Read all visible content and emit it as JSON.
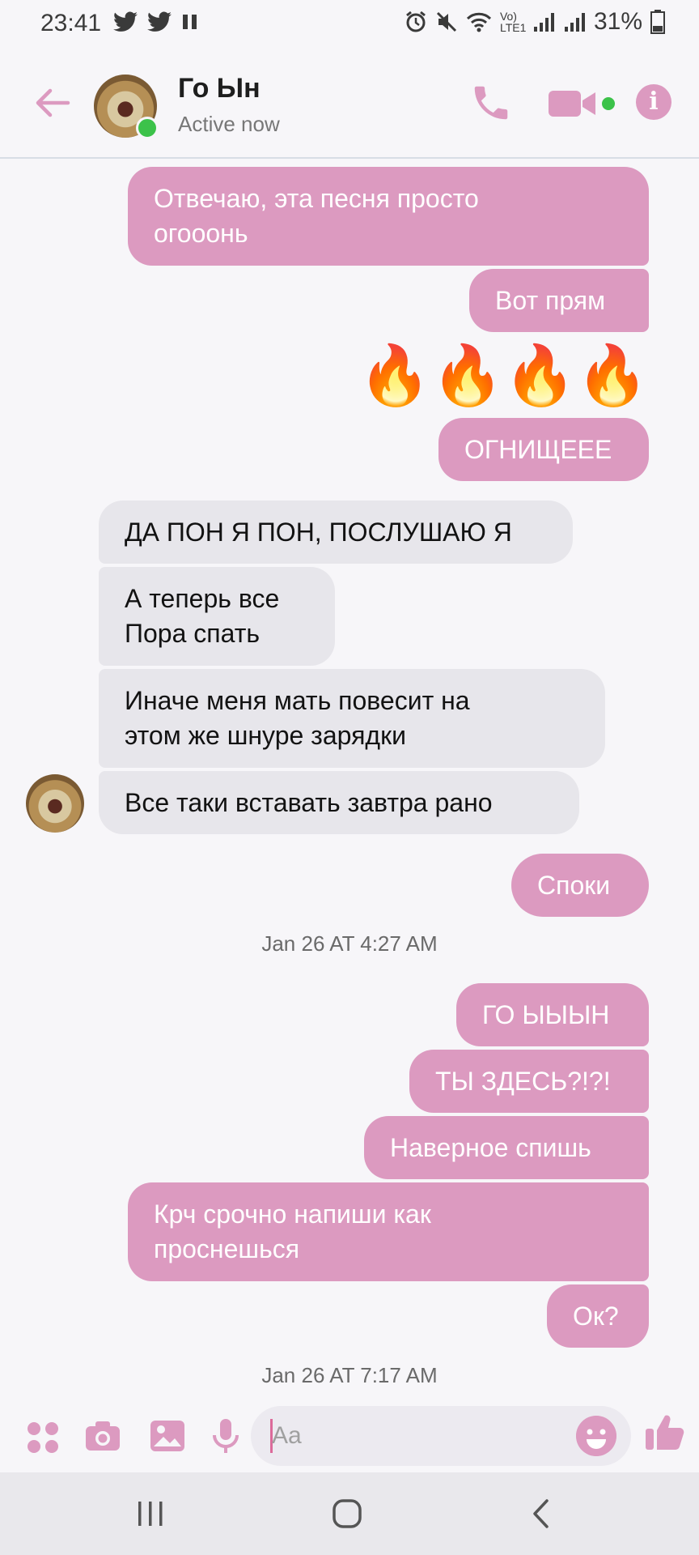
{
  "status_bar": {
    "time": "23:41",
    "notification_icons": [
      "twitter-icon",
      "twitter-icon",
      "pause-icon"
    ],
    "network_label": "Vo) LTE1",
    "battery": "31%",
    "right_icons": [
      "alarm-icon",
      "mute-icon",
      "wifi-icon",
      "signal-icon",
      "signal-icon",
      "battery-icon"
    ]
  },
  "header": {
    "name": "Го Ын",
    "status": "Active now",
    "accent": "#dc9ac0",
    "online_color": "#3cc24a"
  },
  "messages": [
    {
      "dir": "out",
      "text": "Отвечаю, эта песня просто\nогооонь"
    },
    {
      "dir": "out",
      "text": "Вот прям"
    },
    {
      "dir": "out",
      "type": "emoji",
      "text": "🔥🔥🔥🔥"
    },
    {
      "dir": "out",
      "text": "ОГНИЩЕЕЕ"
    },
    {
      "dir": "in",
      "text": "ДА ПОН Я ПОН, ПОСЛУШАЮ Я"
    },
    {
      "dir": "in",
      "text": "А теперь все\nПора спать"
    },
    {
      "dir": "in",
      "text": "Иначе меня мать повесит на\nэтом же шнуре зарядки"
    },
    {
      "dir": "in",
      "text": "Все таки вставать завтра рано"
    },
    {
      "dir": "out",
      "text": "Споки"
    },
    {
      "type": "timestamp",
      "text": "Jan 26 AT 4:27 AM"
    },
    {
      "dir": "out",
      "text": "ГО ЫЫЫН"
    },
    {
      "dir": "out",
      "text": "ТЫ ЗДЕСЬ?!?!"
    },
    {
      "dir": "out",
      "text": "Наверное спишь"
    },
    {
      "dir": "out",
      "text": "Крч срочно напиши как\nпроснешься"
    },
    {
      "dir": "out",
      "text": "Ок?"
    },
    {
      "type": "timestamp",
      "text": "Jan 26 AT 7:17 AM"
    }
  ],
  "composer": {
    "placeholder": "Aa",
    "tools": [
      "apps-icon",
      "camera-icon",
      "gallery-icon",
      "microphone-icon"
    ],
    "like_icon": "thumbs-up-icon",
    "emoji_icon": "smiley-icon"
  },
  "nav_bar": {
    "buttons": [
      "recent-apps-icon",
      "home-icon",
      "back-icon"
    ]
  }
}
